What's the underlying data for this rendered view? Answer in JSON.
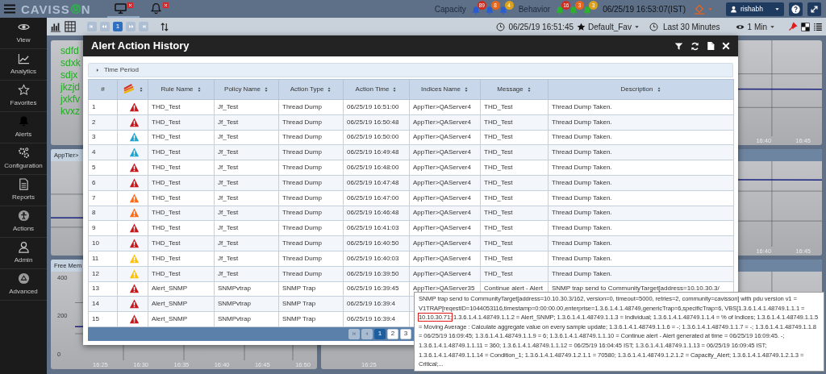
{
  "header": {
    "logo_left": "CAVISS",
    "logo_right": "N",
    "tabs": [
      {
        "kind": "monitor",
        "selected": true
      },
      {
        "kind": "bell",
        "selected": false
      }
    ],
    "capacity_label": "Capacity",
    "capacity_badges": [
      {
        "count": "89",
        "color": "#d42a1e"
      },
      {
        "count": "8",
        "color": "#e8661c"
      },
      {
        "count": "4",
        "color": "#dba11a"
      }
    ],
    "behavior_label": "Behavior",
    "behavior_badges": [
      {
        "count": "16",
        "color": "#d42a1e"
      },
      {
        "count": "3",
        "color": "#e8661c"
      },
      {
        "count": "3",
        "color": "#dba11a"
      }
    ],
    "datetime": "06/25/19 16:53:07(IST)",
    "user": "rishabh"
  },
  "sidebar": {
    "items": [
      {
        "label": "View",
        "kind": "eye"
      },
      {
        "label": "Analytics",
        "kind": "analytics"
      },
      {
        "label": "Favorites",
        "kind": "star"
      },
      {
        "label": "Alerts",
        "kind": "bell"
      },
      {
        "label": "Configuration",
        "kind": "gears"
      },
      {
        "label": "Reports",
        "kind": "document"
      },
      {
        "label": "Actions",
        "kind": "actions"
      },
      {
        "label": "Admin",
        "kind": "person"
      },
      {
        "label": "Advanced",
        "kind": "advanced"
      }
    ]
  },
  "toolbar": {
    "pages": [
      {
        "label": "1",
        "selected": true
      }
    ],
    "datetime": "06/25/19 16:51:45",
    "favorite": "Default_Fav",
    "range": "Last 30 Minutes",
    "interval": "1 Min"
  },
  "dashboard": {
    "panels": [
      {
        "kind": "notes",
        "lines": [
          "sdfd",
          "sdxk",
          "sdjx",
          "jkzjd",
          "jxkfv",
          "kvxz"
        ]
      },
      {
        "kind": "chart",
        "header": false,
        "ticks": [
          "16:40",
          "16:45"
        ]
      },
      {
        "kind": "chart",
        "header": true,
        "title": "AppTier>"
      },
      {
        "kind": "chart",
        "header": true,
        "ticks": [
          "16:40",
          "16:45"
        ]
      },
      {
        "kind": "chart",
        "header": true,
        "title": "Free Mem",
        "y_ticks": [
          "400",
          "200",
          "0"
        ],
        "ticks": [
          "16:25",
          "16:30",
          "16:35",
          "16:40",
          "16:45",
          "16:50"
        ]
      },
      {
        "kind": "chart",
        "header": true,
        "ticks": [
          "16:25"
        ]
      }
    ]
  },
  "modal": {
    "title": "Alert Action History",
    "section": {
      "label": "Time Period",
      "expanded": false
    },
    "table": {
      "columns": [
        {
          "label": "#",
          "sortable": false
        },
        {
          "kind": "severity",
          "sortable": true
        },
        {
          "label": "Rule Name",
          "sortable": true
        },
        {
          "label": "Policy Name",
          "sortable": true
        },
        {
          "label": "Action Type",
          "sortable": true
        },
        {
          "label": "Action Time",
          "sortable": true
        },
        {
          "label": "Indices Name",
          "sortable": true
        },
        {
          "label": "Message",
          "sortable": true
        },
        {
          "label": "Description",
          "sortable": true
        }
      ],
      "rows": [
        {
          "color": "#c8161d",
          "cells": [
            "1",
            "",
            "THD_Test",
            "Jf_Test",
            "Thread Dump",
            "06/25/19 16:51:00",
            "AppTier>QAServer4",
            "THD_Test",
            "Thread Dump Taken."
          ]
        },
        {
          "color": "#c8161d",
          "cells": [
            "2",
            "",
            "THD_Test",
            "Jf_Test",
            "Thread Dump",
            "06/25/19 16:50:48",
            "AppTier>QAServer4",
            "THD_Test",
            "Thread Dump Taken."
          ]
        },
        {
          "color": "#1ba6d2",
          "cells": [
            "3",
            "",
            "THD_Test",
            "Jf_Test",
            "Thread Dump",
            "06/25/19 16:50:00",
            "AppTier>QAServer4",
            "THD_Test",
            "Thread Dump Taken."
          ]
        },
        {
          "color": "#1ba6d2",
          "cells": [
            "4",
            "",
            "THD_Test",
            "Jf_Test",
            "Thread Dump",
            "06/25/19 16:49:48",
            "AppTier>QAServer4",
            "THD_Test",
            "Thread Dump Taken."
          ]
        },
        {
          "color": "#c8161d",
          "cells": [
            "5",
            "",
            "THD_Test",
            "Jf_Test",
            "Thread Dump",
            "06/25/19 16:48:00",
            "AppTier>QAServer4",
            "THD_Test",
            "Thread Dump Taken."
          ]
        },
        {
          "color": "#c8161d",
          "cells": [
            "6",
            "",
            "THD_Test",
            "Jf_Test",
            "Thread Dump",
            "06/25/19 16:47:48",
            "AppTier>QAServer4",
            "THD_Test",
            "Thread Dump Taken."
          ]
        },
        {
          "color": "#ff6a13",
          "cells": [
            "7",
            "",
            "THD_Test",
            "Jf_Test",
            "Thread Dump",
            "06/25/19 16:47:00",
            "AppTier>QAServer4",
            "THD_Test",
            "Thread Dump Taken."
          ]
        },
        {
          "color": "#ff6a13",
          "cells": [
            "8",
            "",
            "THD_Test",
            "Jf_Test",
            "Thread Dump",
            "06/25/19 16:46:48",
            "AppTier>QAServer4",
            "THD_Test",
            "Thread Dump Taken."
          ]
        },
        {
          "color": "#c8161d",
          "cells": [
            "9",
            "",
            "THD_Test",
            "Jf_Test",
            "Thread Dump",
            "06/25/19 16:41:03",
            "AppTier>QAServer4",
            "THD_Test",
            "Thread Dump Taken."
          ]
        },
        {
          "color": "#c8161d",
          "cells": [
            "10",
            "",
            "THD_Test",
            "Jf_Test",
            "Thread Dump",
            "06/25/19 16:40:50",
            "AppTier>QAServer4",
            "THD_Test",
            "Thread Dump Taken."
          ]
        },
        {
          "color": "#ffc107",
          "cells": [
            "11",
            "",
            "THD_Test",
            "Jf_Test",
            "Thread Dump",
            "06/25/19 16:40:03",
            "AppTier>QAServer4",
            "THD_Test",
            "Thread Dump Taken."
          ]
        },
        {
          "color": "#ffc107",
          "cells": [
            "12",
            "",
            "THD_Test",
            "Jf_Test",
            "Thread Dump",
            "06/25/19 16:39:50",
            "AppTier>QAServer4",
            "THD_Test",
            "Thread Dump Taken."
          ]
        },
        {
          "color": "#c8161d",
          "cells": [
            "13",
            "",
            "Alert_SNMP",
            "SNMPvtrap",
            "SNMP Trap",
            "06/25/19 16:39:45",
            "AppTier>QAServer35",
            "Continue alert - Alert",
            "SNMP trap send to CommunityTarget[address=10.10.30.3/"
          ]
        },
        {
          "color": "#c8161d",
          "cells": [
            "14",
            "",
            "Alert_SNMP",
            "SNMPvtrap",
            "SNMP Trap",
            "06/25/19 16:39:4"
          ]
        },
        {
          "color": "#c8161d",
          "cells": [
            "15",
            "",
            "Alert_SNMP",
            "SNMPvtrap",
            "SNMP Trap",
            "06/25/19 16:39:4"
          ]
        }
      ]
    },
    "pager": {
      "pages": [
        {
          "label": "1",
          "selected": true
        },
        {
          "label": "2",
          "selected": false
        },
        {
          "label": "3",
          "selected": false
        }
      ]
    }
  },
  "tooltip": {
    "before": "SNMP trap send to CommunityTarget[address=10.10.30.3/162, version=0, timeout=5000, retries=2, community=cavisson]  with pdu version v1 = V1TRAP[reqestID=1044053116,timestamp=0:00:00.00,enterprise=1.3.6.1.4.1.48749,genericTrap=6,specificTrap=6, VBS[1.3.6.1.4.1.48749.1.1.1 = ",
    "highlighted": "10.10.30.71;",
    "after": " 1.3.6.1.4.1.48749.1.1.2 = Alert_SNMP; 1.3.6.1.4.1.48749.1.1.3 = Individual; 1.3.6.1.4.1.48749.1.1.4 = % of Indices; 1.3.6.1.4.1.48749.1.1.5 = Moving Average : Calculate aggregate value on every sample update; 1.3.6.1.4.1.48749.1.1.6 = -; 1.3.6.1.4.1.48749.1.1.7 = -; 1.3.6.1.4.1.48749.1.1.8 = 06/25/19 16:09:45; 1.3.6.1.4.1.48749.1.1.9 = 6; 1.3.6.1.4.1.48749.1.1.10 = Continue alert - Alert generated at time = 06/25/19 16:09:45. -; 1.3.6.1.4.1.48749.1.1.11 = 360; 1.3.6.1.4.1.48749.1.1.12 = 06/25/19 16:04:45 IST; 1.3.6.1.4.1.48749.1.1.13 = 06/25/19 16:09:45 IST; 1.3.6.1.4.1.48749.1.1.14 = Condition_1; 1.3.6.1.4.1.48749.1.2.1.1 = 70580; 1.3.6.1.4.1.48749.1.2.1.2 = Capacity_Alert; 1.3.6.1.4.1.48749.1.2.1.3 = Critical;..."
  }
}
